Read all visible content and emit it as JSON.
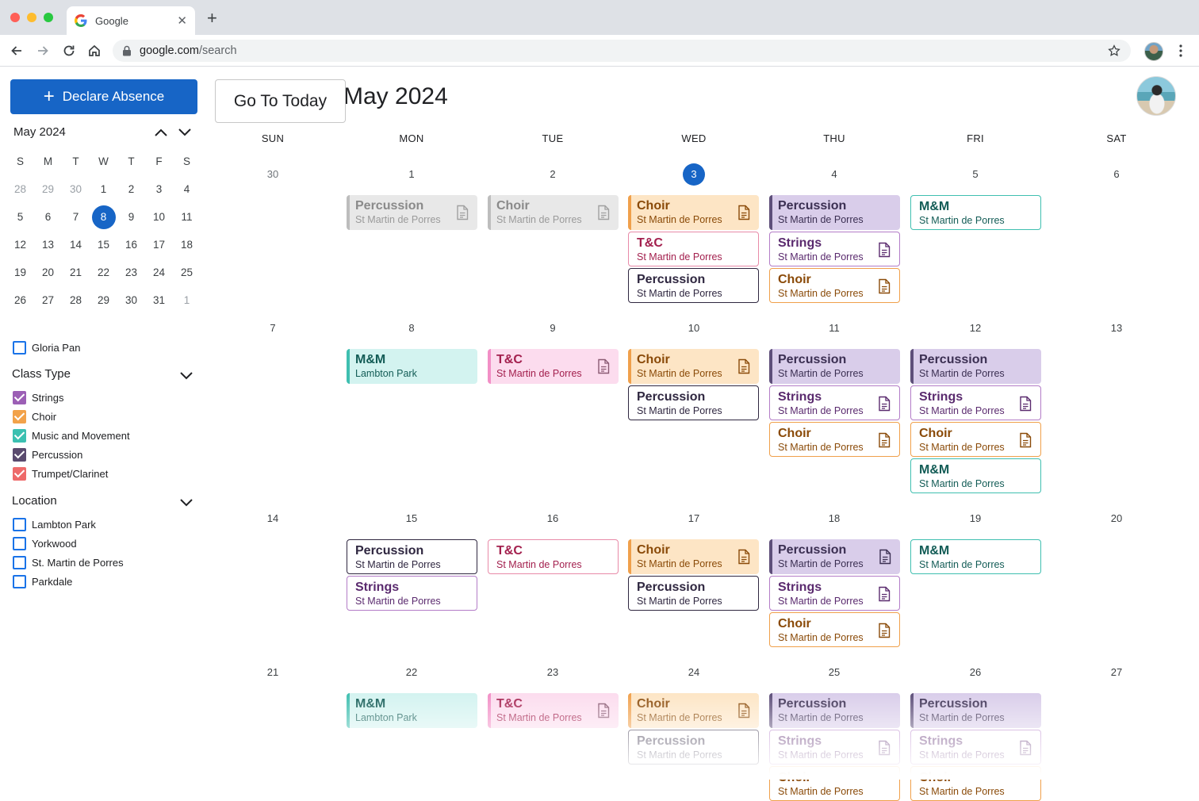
{
  "browser": {
    "tab_title": "Google",
    "url_host": "google.com",
    "url_path": "/search"
  },
  "sidebar": {
    "declare_label": "Declare Absence",
    "mini_calendar": {
      "month_label": "May 2024",
      "weekday_initials": [
        "S",
        "M",
        "T",
        "W",
        "T",
        "F",
        "S"
      ],
      "weeks": [
        [
          "28",
          "29",
          "30",
          "1",
          "2",
          "3",
          "4"
        ],
        [
          "5",
          "6",
          "7",
          "8",
          "9",
          "10",
          "11"
        ],
        [
          "12",
          "13",
          "14",
          "15",
          "16",
          "17",
          "18"
        ],
        [
          "19",
          "20",
          "21",
          "22",
          "23",
          "24",
          "25"
        ],
        [
          "26",
          "27",
          "28",
          "29",
          "30",
          "31",
          "1"
        ]
      ],
      "selected": "8"
    },
    "teacher": {
      "label": "Gloria Pan",
      "checked": false
    },
    "class_type": {
      "heading": "Class Type",
      "items": [
        {
          "label": "Strings",
          "color": "#9c5fb5",
          "checked": true
        },
        {
          "label": "Choir",
          "color": "#f2a24a",
          "checked": true
        },
        {
          "label": "Music and Movement",
          "color": "#3cc0b1",
          "checked": true
        },
        {
          "label": "Percussion",
          "color": "#5a4a6e",
          "checked": true
        },
        {
          "label": "Trumpet/Clarinet",
          "color": "#ee6a6a",
          "checked": true
        }
      ]
    },
    "location": {
      "heading": "Location",
      "items": [
        {
          "label": "Lambton Park",
          "checked": false
        },
        {
          "label": "Yorkwood",
          "checked": false
        },
        {
          "label": "St. Martin de Porres",
          "checked": false
        },
        {
          "label": "Parkdale",
          "checked": false
        }
      ]
    }
  },
  "calendar": {
    "goto_label": "Go To Today",
    "month_title": "May 2024",
    "weekdays": [
      "SUN",
      "MON",
      "TUE",
      "WED",
      "THU",
      "FRI",
      "SAT"
    ],
    "today": "3",
    "weeks": [
      {
        "days": [
          "30",
          "1",
          "2",
          "3",
          "4",
          "5",
          "6"
        ],
        "events": [
          [],
          [
            {
              "title": "Percussion",
              "loc": "St Martin de Porres",
              "kind": "past",
              "doc": true
            }
          ],
          [
            {
              "title": "Choir",
              "loc": "St Martin de Porres",
              "kind": "past",
              "doc": true
            }
          ],
          [
            {
              "title": "Choir",
              "loc": "St Martin de Porres",
              "kind": "choir-fill",
              "doc": true
            },
            {
              "title": "T&C",
              "loc": "St Martin de Porres",
              "kind": "tc-line",
              "doc": false
            },
            {
              "title": "Percussion",
              "loc": "St Martin de Porres",
              "kind": "perc-line",
              "doc": false
            }
          ],
          [
            {
              "title": "Percussion",
              "loc": "St Martin de Porres",
              "kind": "perc-fill",
              "doc": false
            },
            {
              "title": "Strings",
              "loc": "St Martin de Porres",
              "kind": "strings-line",
              "doc": true
            },
            {
              "title": "Choir",
              "loc": "St Martin de Porres",
              "kind": "choir-line",
              "doc": true
            }
          ],
          [
            {
              "title": "M&M",
              "loc": "St Martin de Porres",
              "kind": "mm-line",
              "doc": false
            }
          ],
          []
        ]
      },
      {
        "days": [
          "7",
          "8",
          "9",
          "10",
          "11",
          "12",
          "13"
        ],
        "events": [
          [],
          [
            {
              "title": "M&M",
              "loc": "Lambton Park",
              "kind": "mm-fill",
              "doc": false
            }
          ],
          [
            {
              "title": "T&C",
              "loc": "St Martin de Porres",
              "kind": "tc-fill",
              "doc": true
            }
          ],
          [
            {
              "title": "Choir",
              "loc": "St Martin de Porres",
              "kind": "choir-fill",
              "doc": true
            },
            {
              "title": "Percussion",
              "loc": "St Martin de Porres",
              "kind": "perc-line",
              "doc": false
            }
          ],
          [
            {
              "title": "Percussion",
              "loc": "St Martin de Porres",
              "kind": "perc-fill",
              "doc": false
            },
            {
              "title": "Strings",
              "loc": "St Martin de Porres",
              "kind": "strings-line",
              "doc": true
            },
            {
              "title": "Choir",
              "loc": "St Martin de Porres",
              "kind": "choir-line",
              "doc": true
            }
          ],
          [
            {
              "title": "Percussion",
              "loc": "St Martin de Porres",
              "kind": "perc-fill",
              "doc": false
            },
            {
              "title": "Strings",
              "loc": "St Martin de Porres",
              "kind": "strings-line",
              "doc": true
            },
            {
              "title": "Choir",
              "loc": "St Martin de Porres",
              "kind": "choir-line",
              "doc": true
            },
            {
              "title": "M&M",
              "loc": "St Martin de Porres",
              "kind": "mm-line",
              "doc": false
            }
          ],
          []
        ]
      },
      {
        "days": [
          "14",
          "15",
          "16",
          "17",
          "18",
          "19",
          "20"
        ],
        "events": [
          [],
          [
            {
              "title": "Percussion",
              "loc": "St Martin de Porres",
              "kind": "perc-line",
              "doc": false
            },
            {
              "title": "Strings",
              "loc": "St Martin de Porres",
              "kind": "strings-line",
              "doc": false
            }
          ],
          [
            {
              "title": "T&C",
              "loc": "St Martin de Porres",
              "kind": "tc-line",
              "doc": false
            }
          ],
          [
            {
              "title": "Choir",
              "loc": "St Martin de Porres",
              "kind": "choir-fill",
              "doc": true
            },
            {
              "title": "Percussion",
              "loc": "St Martin de Porres",
              "kind": "perc-line",
              "doc": false
            }
          ],
          [
            {
              "title": "Percussion",
              "loc": "St Martin de Porres",
              "kind": "perc-fill",
              "doc": true
            },
            {
              "title": "Strings",
              "loc": "St Martin de Porres",
              "kind": "strings-line",
              "doc": true
            },
            {
              "title": "Choir",
              "loc": "St Martin de Porres",
              "kind": "choir-line",
              "doc": true
            }
          ],
          [
            {
              "title": "M&M",
              "loc": "St Martin de Porres",
              "kind": "mm-line",
              "doc": false
            }
          ],
          []
        ]
      },
      {
        "days": [
          "21",
          "22",
          "23",
          "24",
          "25",
          "26",
          "27"
        ],
        "events": [
          [],
          [
            {
              "title": "M&M",
              "loc": "Lambton Park",
              "kind": "mm-fill",
              "doc": false
            }
          ],
          [
            {
              "title": "T&C",
              "loc": "St Martin de Porres",
              "kind": "tc-fill",
              "doc": true
            }
          ],
          [
            {
              "title": "Choir",
              "loc": "St Martin de Porres",
              "kind": "choir-fill",
              "doc": true
            },
            {
              "title": "Percussion",
              "loc": "St Martin de Porres",
              "kind": "perc-line",
              "doc": false
            }
          ],
          [
            {
              "title": "Percussion",
              "loc": "St Martin de Porres",
              "kind": "perc-fill",
              "doc": false
            },
            {
              "title": "Strings",
              "loc": "St Martin de Porres",
              "kind": "strings-line",
              "doc": true
            },
            {
              "title": "Choir",
              "loc": "St Martin de Porres",
              "kind": "choir-line",
              "doc": false
            }
          ],
          [
            {
              "title": "Percussion",
              "loc": "St Martin de Porres",
              "kind": "perc-fill",
              "doc": false
            },
            {
              "title": "Strings",
              "loc": "St Martin de Porres",
              "kind": "strings-line",
              "doc": true
            },
            {
              "title": "Choir",
              "loc": "St Martin de Porres",
              "kind": "choir-line",
              "doc": false
            }
          ],
          []
        ]
      }
    ]
  },
  "event_styles": {
    "past": {
      "bg": "#e8e8e8",
      "border": "#bdbdbd",
      "title": "#8a8a8a",
      "loc": "#9a9a9a",
      "doc": "#a0a0a0"
    },
    "choir-fill": {
      "bg": "#fde5c5",
      "border": "#f0a04b",
      "title": "#8a4a08",
      "loc": "#8a4a08",
      "doc": "#8a4a08"
    },
    "choir-line": {
      "bg": "#ffffff",
      "border": "#f0a04b",
      "title": "#8a4a08",
      "loc": "#8a4a08",
      "doc": "#8a4a08"
    },
    "tc-fill": {
      "bg": "#fcdcee",
      "border": "#f28fc6",
      "title": "#a3204e",
      "loc": "#a3204e",
      "doc": "#8a5a73"
    },
    "tc-line": {
      "bg": "#ffffff",
      "border": "#e88aa8",
      "title": "#a3204e",
      "loc": "#a3204e",
      "doc": "#a3204e"
    },
    "perc-fill": {
      "bg": "#d9cdea",
      "border": "#5e4f7a",
      "title": "#3b2f52",
      "loc": "#3b2f52",
      "doc": "#3b2f52"
    },
    "perc-line": {
      "bg": "#ffffff",
      "border": "#2f2740",
      "title": "#2f2740",
      "loc": "#2f2740",
      "doc": "#2f2740"
    },
    "strings-line": {
      "bg": "#ffffff",
      "border": "#b37cc7",
      "title": "#5a2a6e",
      "loc": "#5a2a6e",
      "doc": "#5a2a6e"
    },
    "mm-fill": {
      "bg": "#d3f3f0",
      "border": "#3fbfb0",
      "title": "#135c56",
      "loc": "#135c56",
      "doc": "#135c56"
    },
    "mm-line": {
      "bg": "#ffffff",
      "border": "#3fbfb0",
      "title": "#135c56",
      "loc": "#135c56",
      "doc": "#135c56"
    }
  }
}
